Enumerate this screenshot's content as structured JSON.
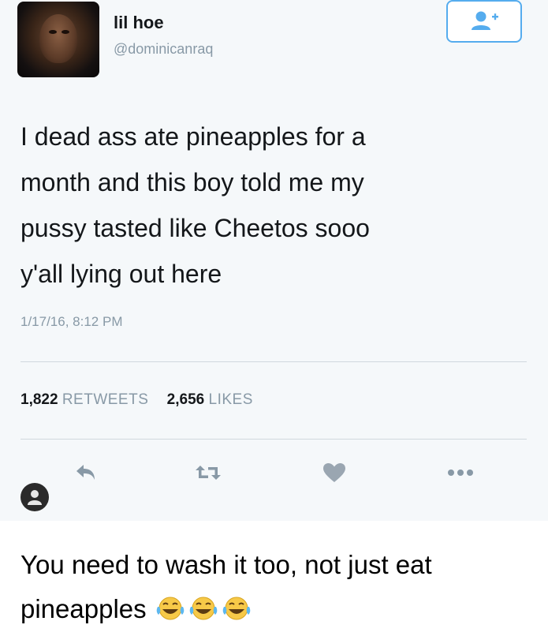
{
  "tweet": {
    "display_name": "lil hoe",
    "handle": "@dominicanraq",
    "text": "I dead ass ate pineapples for a\nmonth and this boy told me my\npussy tasted like Cheetos sooo\ny'all lying out here",
    "timestamp": "1/17/16, 8:12 PM",
    "retweet_count": "1,822",
    "retweet_label": "RETWEETS",
    "like_count": "2,656",
    "like_label": "LIKES",
    "icons": {
      "follow": "follow-user-icon",
      "reply": "reply-icon",
      "retweet": "retweet-icon",
      "like": "heart-icon",
      "more": "more-icon",
      "profile": "user-avatar-icon"
    },
    "colors": {
      "accent": "#55acee",
      "icon_gray": "#8899a6",
      "heart_gray": "#9aa6b1"
    }
  },
  "comment": {
    "text": "You need to wash it too, not just eat pineapples",
    "emoji": [
      "laughing-tears-emoji",
      "laughing-tears-emoji",
      "laughing-tears-emoji"
    ]
  }
}
